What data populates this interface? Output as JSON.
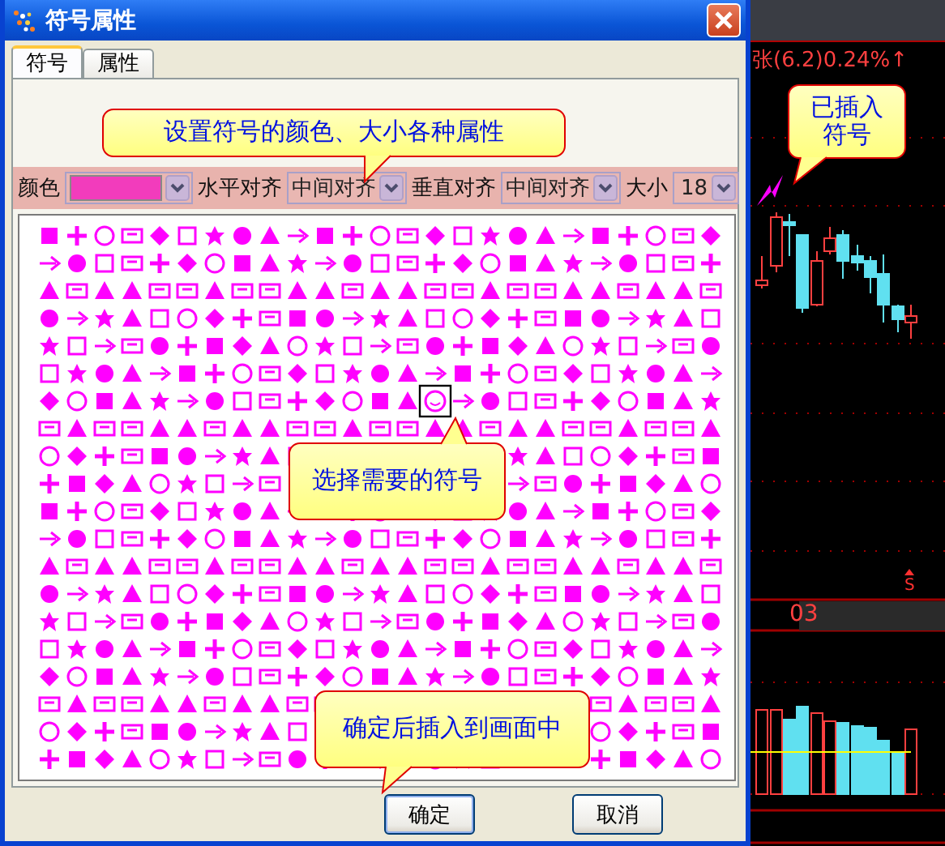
{
  "dialog": {
    "title": "符号属性",
    "tabs": [
      {
        "label": "符号",
        "selected": true
      },
      {
        "label": "属性",
        "selected": false
      }
    ],
    "settings_hint": "设置符号的颜色、大小各种属性",
    "toolbar": {
      "color_label": "颜色",
      "h_align_label": "水平对齐",
      "h_align": "中间对齐",
      "v_align_label": "垂直对齐",
      "v_align": "中间对齐",
      "size_label": "大小",
      "size": "18"
    },
    "grid_hint": "选择需要的符号",
    "confirm_hint": "确定后插入到画面中",
    "buttons": [
      "确定",
      "取消"
    ]
  },
  "chart": {
    "caption": "张(6.2)0.24%↑",
    "callout": "已插入符号",
    "marker": "S",
    "period_label": "03"
  }
}
